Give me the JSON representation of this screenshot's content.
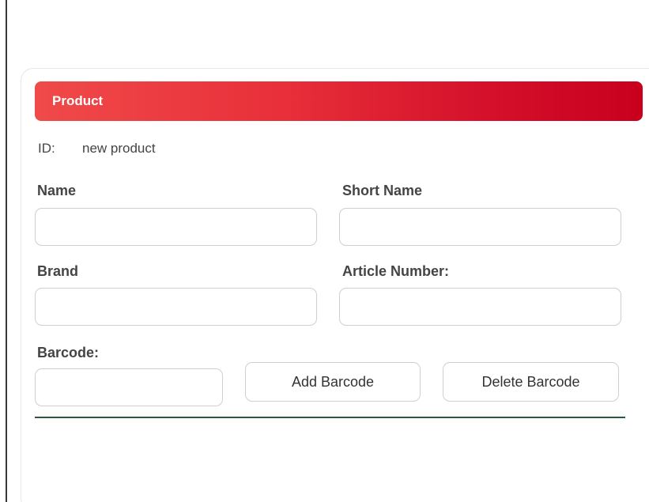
{
  "panel": {
    "title": "Product"
  },
  "id_row": {
    "label": "ID:",
    "value": "new product"
  },
  "fields": {
    "name": {
      "label": "Name",
      "value": "",
      "placeholder": ""
    },
    "short_name": {
      "label": "Short Name",
      "value": "",
      "placeholder": ""
    },
    "brand": {
      "label": "Brand",
      "value": "",
      "placeholder": ""
    },
    "article_number": {
      "label": "Article Number:",
      "value": "",
      "placeholder": ""
    },
    "barcode": {
      "label": "Barcode:",
      "value": "",
      "placeholder": ""
    }
  },
  "buttons": {
    "add_barcode": "Add Barcode",
    "delete_barcode": "Delete Barcode"
  },
  "colors": {
    "header_start": "#f04a4a",
    "header_end": "#c8001e",
    "divider": "#2e5a3c"
  }
}
